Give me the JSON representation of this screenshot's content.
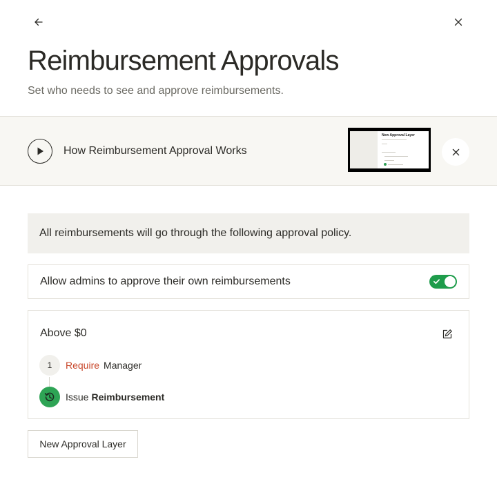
{
  "header": {
    "title": "Reimbursement Approvals",
    "subtitle": "Set who needs to see and approve reimbursements.",
    "back_icon": "arrow-left-icon",
    "close_icon": "close-icon"
  },
  "video_banner": {
    "title": "How Reimbursement Approval Works",
    "thumbnail_heading": "New Approval Layer",
    "play_icon": "play-icon",
    "close_icon": "close-icon"
  },
  "policy_notice": {
    "text": "All reimbursements will go through the following approval policy."
  },
  "admin_setting": {
    "label": "Allow admins to approve their own reimbursements",
    "enabled": true
  },
  "approval_policy": {
    "threshold_label": "Above $0",
    "edit_icon": "edit-icon",
    "steps": [
      {
        "number": "1",
        "action": "Require",
        "approver": "Manager"
      }
    ],
    "final_step": {
      "prefix": "Issue",
      "emphasis": "Reimbursement"
    }
  },
  "actions": {
    "new_layer_label": "New Approval Layer"
  },
  "colors": {
    "accent_green": "#1e9c4b",
    "require_red": "#c8472a",
    "banner_bg": "#f8f7f3",
    "notice_bg": "#f1f0ec"
  }
}
